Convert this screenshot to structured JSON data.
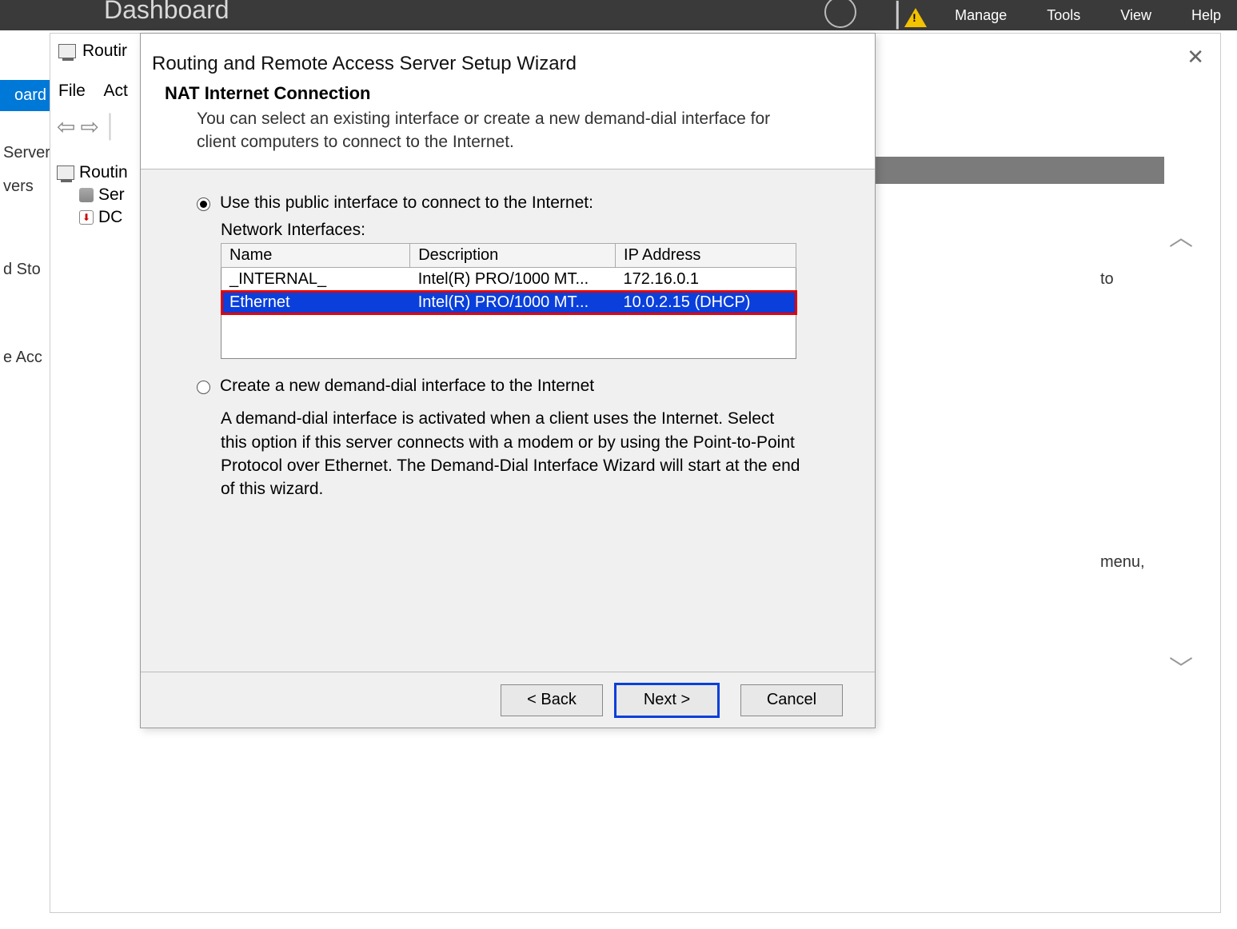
{
  "topbar": {
    "title": "Dashboard",
    "menu": [
      "Manage",
      "Tools",
      "View",
      "Help"
    ]
  },
  "sidebar": {
    "items": [
      {
        "label": "oard",
        "selected": true
      },
      {
        "label": "Server"
      },
      {
        "label": "vers"
      },
      {
        "label": "d Sto"
      },
      {
        "label": "e Acc"
      }
    ]
  },
  "bg_window": {
    "title_frag": "Routir",
    "menu": {
      "file": "File",
      "action": "Act"
    },
    "tree": {
      "root": "Routin",
      "child1": "Ser",
      "child2": "DC"
    },
    "right_frag1": "to",
    "right_frag2": "menu,"
  },
  "wizard": {
    "title": "Routing and Remote Access Server Setup Wizard",
    "subtitle": "NAT Internet Connection",
    "description": "You can select an existing interface or create a new demand-dial interface for client computers to connect to the Internet.",
    "option1_label": "Use this public interface to connect to the Internet:",
    "network_interfaces_label": "Network Interfaces:",
    "table": {
      "headers": {
        "name": "Name",
        "description": "Description",
        "ip": "IP Address"
      },
      "rows": [
        {
          "name": "_INTERNAL_",
          "description": "Intel(R) PRO/1000 MT...",
          "ip": "172.16.0.1",
          "selected": false
        },
        {
          "name": "Ethernet",
          "description": "Intel(R) PRO/1000 MT...",
          "ip": "10.0.2.15 (DHCP)",
          "selected": true
        }
      ]
    },
    "option2_label": "Create a new demand-dial interface to the Internet",
    "option2_description": "A demand-dial interface is activated when a client uses the Internet. Select this option if this server connects with a modem or by using the Point-to-Point Protocol over Ethernet. The Demand-Dial Interface Wizard will start at the end of this wizard.",
    "buttons": {
      "back": "< Back",
      "next": "Next >",
      "cancel": "Cancel"
    }
  }
}
